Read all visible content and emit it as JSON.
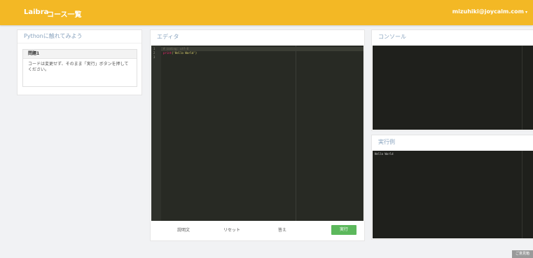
{
  "navbar": {
    "brand": "Laibra",
    "course_link": "コース一覧",
    "user_email": "mizuhiki@joycalm.com",
    "caret": "▾",
    "color": "#f3b825"
  },
  "lesson": {
    "title": "Pythonに触れてみよう",
    "problem_title": "問題1",
    "problem_text": "コードは変更せず、そのまま「実行」ボタンを押してください。"
  },
  "editor": {
    "title": "エディタ",
    "line_numbers": [
      "1",
      "2",
      "3"
    ],
    "code": {
      "line1": "# coding: utf-8",
      "line2_fn": "print",
      "line2_rest": "('Hello World')"
    },
    "buttons": {
      "explain": "説明文",
      "reset": "リセット",
      "hint": "答え",
      "run": "実行"
    },
    "run_color": "#5cb85c"
  },
  "console": {
    "title": "コンソール"
  },
  "example": {
    "title": "実行例",
    "output": "Hello World"
  },
  "footer": {
    "badge": "ご意見箱"
  }
}
